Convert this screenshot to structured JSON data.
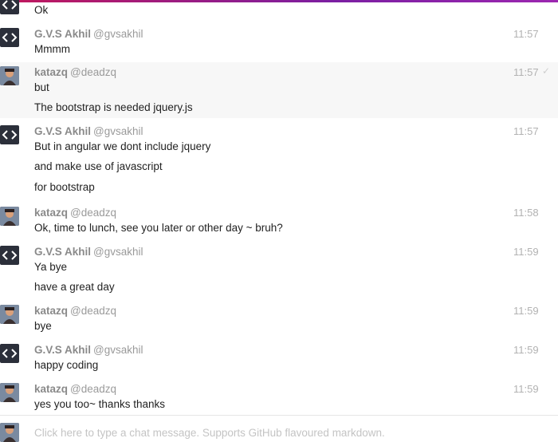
{
  "users": {
    "gv": {
      "name": "G.V.S Akhil",
      "handle": "@gvsakhil"
    },
    "kz": {
      "name": "katazq",
      "handle": "@deadzq"
    }
  },
  "messages": [
    {
      "lines": [
        "Ok"
      ]
    },
    {
      "user": "gv",
      "time": "11:57",
      "lines": [
        "Mmmm"
      ]
    },
    {
      "user": "kz",
      "time": "11:57",
      "lines": [
        "but",
        "The bootstrap is needed jquery.js"
      ]
    },
    {
      "user": "gv",
      "time": "11:57",
      "lines": [
        "But in angular we dont include jquery",
        "and make use of javascript",
        "for bootstrap"
      ]
    },
    {
      "user": "kz",
      "time": "11:58",
      "lines": [
        "Ok, time to lunch, see you later or other day ~ bruh?"
      ]
    },
    {
      "user": "gv",
      "time": "11:59",
      "lines": [
        "Ya bye",
        "have a great day"
      ]
    },
    {
      "user": "kz",
      "time": "11:59",
      "lines": [
        "bye"
      ]
    },
    {
      "user": "gv",
      "time": "11:59",
      "lines": [
        "happy coding"
      ]
    },
    {
      "user": "kz",
      "time": "11:59",
      "lines": [
        "yes you too~ thanks thanks"
      ]
    }
  ],
  "composer": {
    "placeholder": "Click here to type a chat message. Supports GitHub flavoured markdown."
  }
}
